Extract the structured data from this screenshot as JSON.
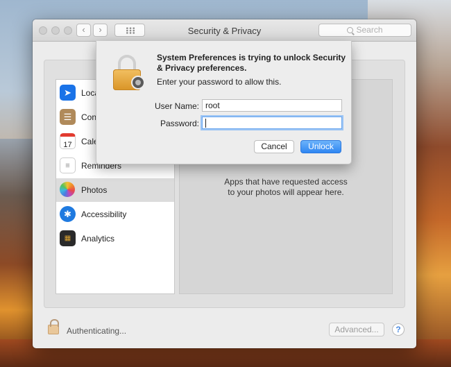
{
  "window": {
    "title": "Security & Privacy",
    "back_glyph": "‹",
    "forward_glyph": "›",
    "search_placeholder": "Search"
  },
  "sidebar": {
    "items": [
      {
        "label": "Location Services",
        "visible_label": "Loca",
        "icon": "location-arrow-icon",
        "color": "#1a73e8"
      },
      {
        "label": "Contacts",
        "visible_label": "Cont",
        "icon": "contacts-book-icon",
        "color": "#b08a5a"
      },
      {
        "label": "Calendars",
        "visible_label": "Cale",
        "icon": "calendar-icon",
        "color": "#ffffff"
      },
      {
        "label": "Reminders",
        "visible_label": "Reminders",
        "icon": "reminders-list-icon",
        "color": "#ffffff"
      },
      {
        "label": "Photos",
        "visible_label": "Photos",
        "icon": "photos-flower-icon",
        "color": "#ffffff",
        "selected": true
      },
      {
        "label": "Accessibility",
        "visible_label": "Accessibility",
        "icon": "accessibility-icon",
        "color": "#1f7ae0"
      },
      {
        "label": "Analytics",
        "visible_label": "Analytics",
        "icon": "analytics-icon",
        "color": "#2a2a2a"
      }
    ],
    "calendar_day": "17"
  },
  "main": {
    "empty_message_line1": "Apps that have requested access",
    "empty_message_line2": "to your photos will appear here."
  },
  "footer": {
    "status": "Authenticating...",
    "advanced_label": "Advanced...",
    "help_label": "?"
  },
  "dialog": {
    "title": "System Preferences is trying to unlock Security & Privacy preferences.",
    "subtitle": "Enter your password to allow this.",
    "username_label": "User Name:",
    "username_value": "root",
    "password_label": "Password:",
    "password_value": "",
    "cancel_label": "Cancel",
    "unlock_label": "Unlock",
    "accent": "#2f86f2"
  }
}
